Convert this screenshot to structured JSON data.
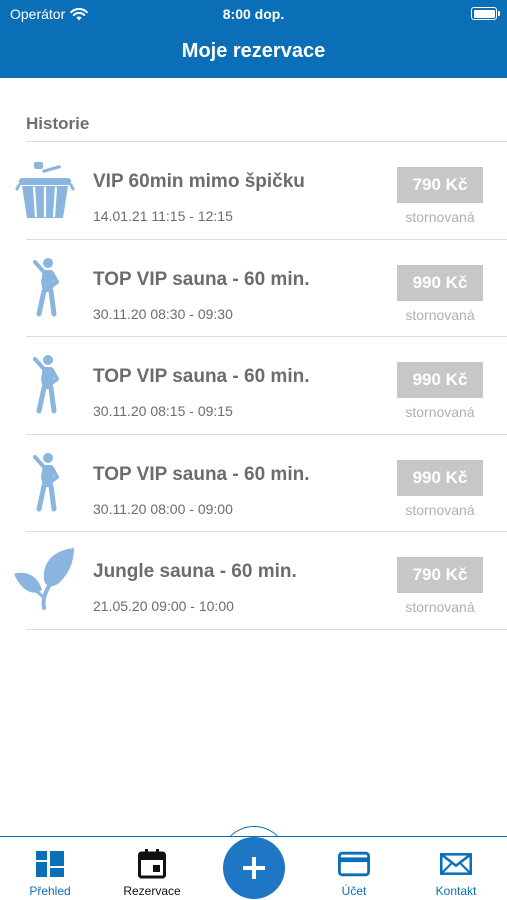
{
  "status_bar": {
    "carrier": "Operátor",
    "time": "8:00 dop."
  },
  "header": {
    "title": "Moje rezervace"
  },
  "section": {
    "title": "Historie"
  },
  "reservations": [
    {
      "icon": "bucket-icon",
      "name": "VIP 60min mimo špičku",
      "datetime": "14.01.21 11:15 - 12:15",
      "price": "790 Kč",
      "status": "stornovaná"
    },
    {
      "icon": "stretching-person-icon",
      "name": "TOP VIP sauna - 60 min.",
      "datetime": "30.11.20 08:30 - 09:30",
      "price": "990 Kč",
      "status": "stornovaná"
    },
    {
      "icon": "stretching-person-icon",
      "name": "TOP VIP sauna - 60 min.",
      "datetime": "30.11.20 08:15 - 09:15",
      "price": "990 Kč",
      "status": "stornovaná"
    },
    {
      "icon": "stretching-person-icon",
      "name": "TOP VIP sauna - 60 min.",
      "datetime": "30.11.20 08:00 - 09:00",
      "price": "990 Kč",
      "status": "stornovaná"
    },
    {
      "icon": "leaves-icon",
      "name": "Jungle sauna - 60 min.",
      "datetime": "21.05.20 09:00 - 10:00",
      "price": "790 Kč",
      "status": "stornovaná"
    }
  ],
  "tabbar": {
    "items": [
      {
        "label": "Přehled",
        "icon": "dashboard-icon",
        "active": false
      },
      {
        "label": "Rezervace",
        "icon": "calendar-icon",
        "active": true
      },
      {
        "label": "Účet",
        "icon": "card-icon",
        "active": false
      },
      {
        "label": "Kontakt",
        "icon": "mail-icon",
        "active": false
      }
    ],
    "add_icon": "plus-icon"
  },
  "colors": {
    "brand": "#0a6fb7",
    "icon": "#8ab5de",
    "price_badge": "#c7c7c7"
  }
}
